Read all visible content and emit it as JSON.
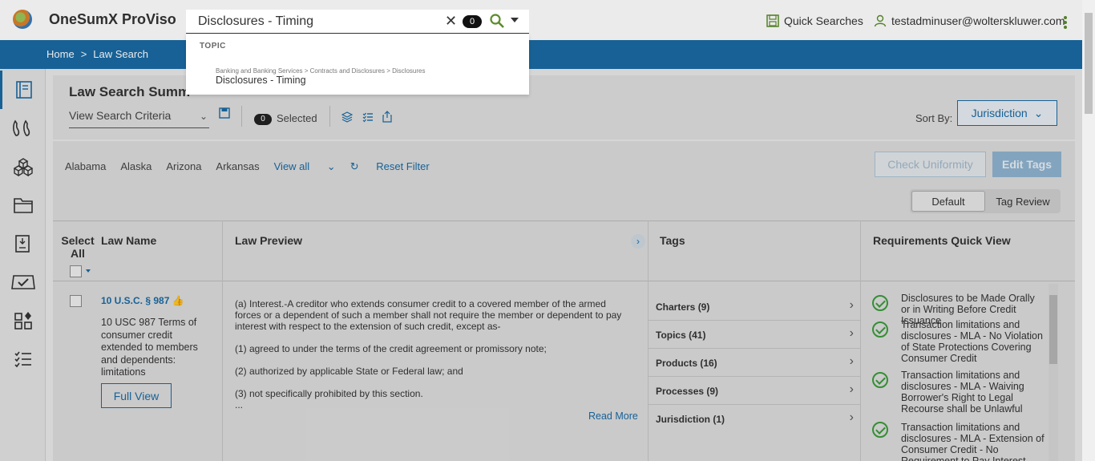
{
  "app": {
    "title": "OneSumX ProViso"
  },
  "header": {
    "quick_searches": "Quick Searches",
    "user": "testadminuser@wolterskluwer.com"
  },
  "breadcrumb": {
    "home": "Home",
    "sep": ">",
    "current": "Law Search"
  },
  "search": {
    "value": "Disclosures - Timing",
    "count": "0",
    "suggest_heading": "TOPIC",
    "suggestion_path": "Banking and Banking Services > Contracts and Disclosures > Disclosures",
    "suggestion_title": "Disclosures - Timing"
  },
  "summary": {
    "title": "Law Search Summ",
    "criteria": "View Search Criteria",
    "selected_count": "0",
    "selected_label": "Selected",
    "sort_label": "Sort By:",
    "sort_value": "Jurisdiction"
  },
  "filters": {
    "states": [
      "Alabama",
      "Alaska",
      "Arizona",
      "Arkansas"
    ],
    "view_all": "View all",
    "reset": "Reset Filter",
    "check_uniformity": "Check Uniformity",
    "edit_tags": "Edit Tags",
    "toggle_default": "Default",
    "toggle_tag_review": "Tag Review"
  },
  "table": {
    "headers": {
      "select": "Select All",
      "law_name": "Law Name",
      "law_preview": "Law Preview",
      "tags": "Tags",
      "requirements": "Requirements Quick View"
    },
    "row": {
      "law_link": "10 U.S.C. § 987",
      "law_desc": "10 USC 987 Terms of consumer credit extended to members and dependents: limitations",
      "full_view": "Full View",
      "preview": [
        "(a) Interest.-A creditor who extends consumer credit to a covered member of the armed forces or a dependent of such a member shall not require the member or dependent to pay interest with respect to the extension of such credit, except as-",
        "(1) agreed to under the terms of the credit agreement or promissory note;",
        "(2) authorized by applicable State or Federal law; and",
        "(3) not specifically prohibited by this section.",
        "..."
      ],
      "read_more": "Read More",
      "tags": [
        "Charters (9)",
        "Topics (41)",
        "Products (16)",
        "Processes (9)",
        "Jurisdiction (1)"
      ],
      "requirements": [
        "Disclosures to be Made Orally or in Writing Before Credit Issuance",
        "Transaction limitations and disclosures - MLA - No Violation of State Protections Covering Consumer Credit",
        "Transaction limitations and disclosures - MLA - Waiving Borrower's Right to Legal Recourse shall be Unlawful",
        "Transaction limitations and disclosures - MLA - Extension of Consumer Credit - No Requirement to Pay Interest"
      ]
    }
  },
  "colors": {
    "brand_blue": "#1a6aa3",
    "accent_green": "#5b8c2a",
    "check_green": "#3a9b3a"
  }
}
